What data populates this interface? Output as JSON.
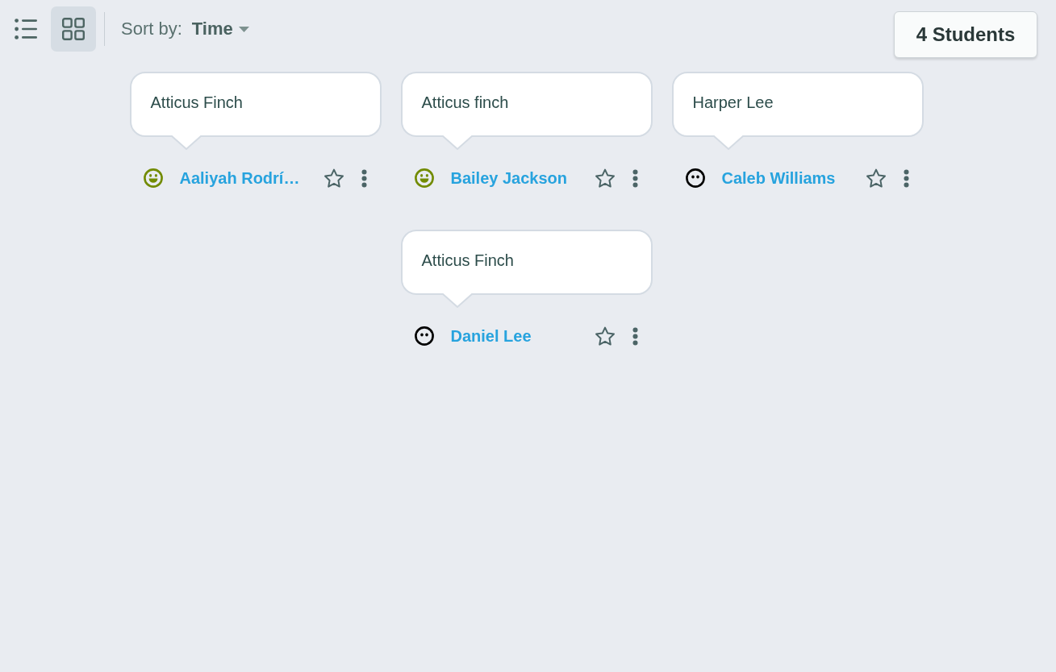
{
  "toolbar": {
    "views": [
      {
        "kind": "list",
        "selected": false
      },
      {
        "kind": "grid",
        "selected": true
      }
    ],
    "sort": {
      "label": "Sort by:",
      "value": "Time"
    },
    "count": "4 Students"
  },
  "students": [
    {
      "answer": "Atticus Finch",
      "name": "Aaliyah Rodrí…",
      "kind": "happy",
      "starred": false
    },
    {
      "answer": "Atticus finch",
      "name": "Bailey Jackson",
      "kind": "happy",
      "starred": false
    },
    {
      "answer": "Harper Lee",
      "name": "Caleb Williams",
      "kind": "neutral",
      "starred": false
    },
    {
      "answer": "Atticus Finch",
      "name": "Daniel Lee",
      "kind": "neutral",
      "starred": false
    }
  ]
}
